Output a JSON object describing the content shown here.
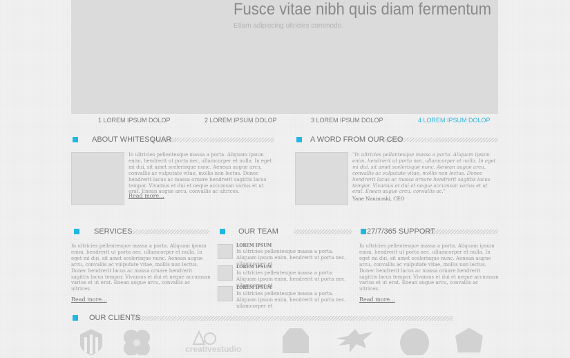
{
  "slider": {
    "title": "Fusce vitae nibh quis diam fermentum",
    "subtitle": "Etiam adipiscing ultricies commodo.",
    "tabs": [
      "1 LOREM IPSUM DOLOP",
      "2 LOREM IPSUM DOLOP",
      "3 LOREM IPSUM DOLOP",
      "4 LOREM IPSUM DOLOP"
    ],
    "active_tab": 4
  },
  "about": {
    "heading": "ABOUT WHITESQUAR",
    "text": "In ultricies pellentesque massa a porta. Aliquam ipsum enim, hendrerit ut porta nec, ullamcorper et nulla. In eget mi dui, sit amet scelerisque nunc. Aenean augue arcu, convallis ac vulputate vitae, mollis non lectus. Donec hendrerit lacus ac massa ornare hendrerit sagittis lacus tempor. Vivamus et dui et neque accumsan varius et ut erat. Enean augue arcu, convallis ac ultrices.",
    "read_more": "Read more..."
  },
  "ceo": {
    "heading": "A WORD FROM OUR CEO",
    "quote": "\"In ultricies pellentesque massa a porta. Aliquam ipsum enim, hendrerit ut porta nec, ullamcorper et nulla. In eget mi dui, sit amet scelerisque nunc. Aenean augue arcu, convallis ac vulputate vitae, mollis non lectus. Donec hendrerit lacus ac massa ornare hendrerit sagittis lacus tempor. Vivamus et dui et neque accumsan varius et ut erat. Enean augue arcu, convallis ac.\"",
    "author": "Yane Naumoski, CEO"
  },
  "services": {
    "heading": "SERVICES",
    "text": "In ultricies pellentesque massa a porta. Aliquam ipsum enim, hendrerit ut porta nec, ullamcorper et nulla. In eget mi dui, sit amet scelerisque nunc. Aenean augue arcu, convallis ac vulputate vitae, mollis non lectus. Donec hendrerit lacus ac massa ornare hendrerit sagittis lacus tempor. Vivamus et dui et neque accumsan varius et ut erat. Enean augue arcu, convallis ac ultrices.",
    "read_more": "Read more..."
  },
  "team": {
    "heading": "OUR TEAM",
    "members": [
      {
        "name": "LOREM IPSUM",
        "text": "In ultricies pellentesque massa a porta. Aliquam ipsum enim, hendrerit ut porta nec, ullamcorper et"
      },
      {
        "name": "LOREM IPSUM",
        "text": "In ultricies pellentesque massa a porta. Aliquam ipsum enim, hendrerit ut porta nec, ullamcorper et"
      },
      {
        "name": "LOREM IPSUM",
        "text": "In ultricies pellentesque massa a porta. Aliquam ipsum enim, hendrerit ut porta nec, ullamcorper et"
      }
    ]
  },
  "support": {
    "heading": "27/7/365 SUPPORT",
    "text": "In ultricies pellentesque massa a porta. Aliquam ipsum enim, hendrerit ut porta nec, ullamcorper et nulla. In eget mi dui, sit amet scelerisque nunc. Aenean augue arcu, convallis ac vulputate vitae, mollis non lectus. Donec hendrerit lacus ac massa ornare hendrerit sagittis lacus tempor. Vivamus et dui et neque accumsan varius et ut erat. Enean augue arcu, convallis ac ultrices.",
    "read_more": "Read more..."
  },
  "clients": {
    "heading": "OUR CLIENTS",
    "logo_text": "creativestudio",
    "logos": [
      "shield-logo-icon",
      "flower-logo-icon",
      "creativestudio-logo-icon",
      "hexagon-logo-icon",
      "bird-logo-icon",
      "circle-logo-icon",
      "cube-logo-icon"
    ]
  },
  "colors": {
    "accent": "#22b6e1",
    "active_tab": "#2cb6dc",
    "placeholder": "#dbdbdb"
  }
}
